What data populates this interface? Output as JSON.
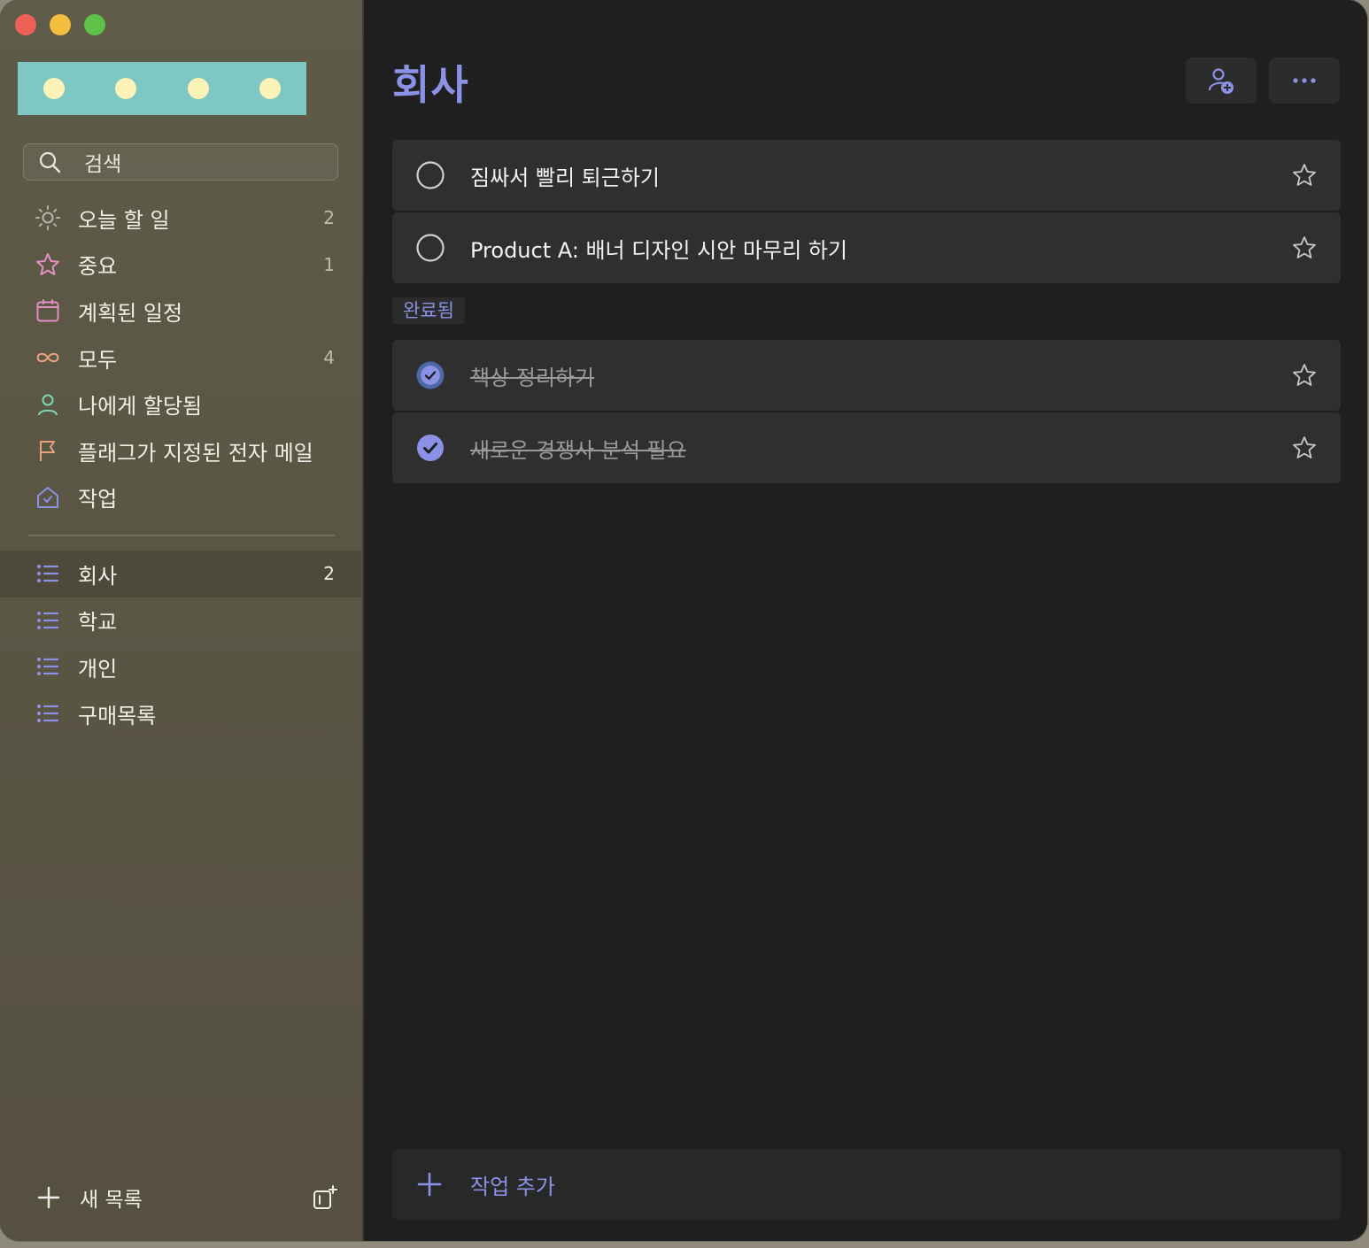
{
  "window": {
    "traffic_lights": [
      "close",
      "minimize",
      "zoom"
    ]
  },
  "sidebar": {
    "search": {
      "placeholder": "검색",
      "icon": "search-icon"
    },
    "smart_lists": [
      {
        "id": "today",
        "label": "오늘 할 일",
        "count": "2",
        "icon": "sun-icon",
        "color": "#b5b2a6"
      },
      {
        "id": "important",
        "label": "중요",
        "count": "1",
        "icon": "star-icon",
        "color": "#e58fc7"
      },
      {
        "id": "planned",
        "label": "계획된 일정",
        "count": "",
        "icon": "calendar-icon",
        "color": "#e58fc7"
      },
      {
        "id": "all",
        "label": "모두",
        "count": "4",
        "icon": "infinity-icon",
        "color": "#e8a27f"
      },
      {
        "id": "assigned",
        "label": "나에게 할당됨",
        "count": "",
        "icon": "person-icon",
        "color": "#7fd6b5"
      },
      {
        "id": "flagged",
        "label": "플래그가 지정된 전자 메일",
        "count": "",
        "icon": "flag-icon",
        "color": "#e8a27f"
      },
      {
        "id": "tasks",
        "label": "작업",
        "count": "",
        "icon": "home-icon",
        "color": "#8b92e6"
      }
    ],
    "user_lists": [
      {
        "id": "company",
        "label": "회사",
        "count": "2",
        "active": true
      },
      {
        "id": "school",
        "label": "학교",
        "count": ""
      },
      {
        "id": "personal",
        "label": "개인",
        "count": ""
      },
      {
        "id": "shopping",
        "label": "구매목록",
        "count": ""
      }
    ],
    "new_list_label": "새 목록"
  },
  "main": {
    "title": "회사",
    "accent_color": "#8b92e6",
    "open_tasks": [
      {
        "text": "짐싸서 빨리 퇴근하기",
        "completed": false,
        "starred": false
      },
      {
        "text": "Product A: 배너 디자인 시안 마무리 하기",
        "completed": false,
        "starred": false
      }
    ],
    "completed_label": "완료됨",
    "completed_tasks": [
      {
        "text": "책상 정리하기",
        "completed": true,
        "starred": false
      },
      {
        "text": "새로운 경쟁사 분석 필요",
        "completed": true,
        "starred": false
      }
    ],
    "add_task_label": "작업 추가"
  }
}
